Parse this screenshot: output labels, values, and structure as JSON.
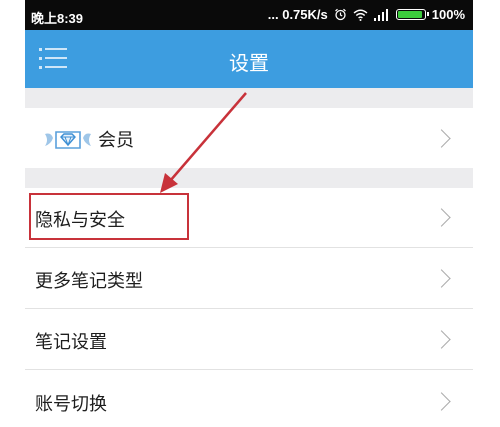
{
  "status_bar": {
    "time": "晚上8:39",
    "network_speed": "... 0.75K/s",
    "battery_percent": "100%",
    "battery_level": 1.0,
    "icons": [
      "alarm-icon",
      "wifi-icon",
      "signal-icon",
      "battery-icon"
    ]
  },
  "header": {
    "title": "设置",
    "menu_icon": "menu-icon"
  },
  "settings": {
    "items": [
      {
        "label": "会员",
        "icon": "vip-diamond-icon"
      },
      {
        "label": "隐私与安全"
      },
      {
        "label": "更多笔记类型"
      },
      {
        "label": "笔记设置"
      },
      {
        "label": "账号切换"
      }
    ]
  },
  "colors": {
    "header_bg": "#3d9de0",
    "highlight": "#c8323a",
    "battery_fill": "#3dcc3d",
    "section_gap": "#ececee"
  }
}
